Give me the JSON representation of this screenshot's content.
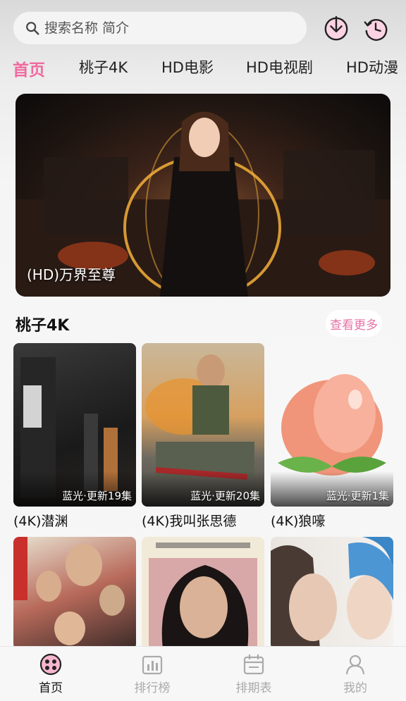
{
  "search": {
    "placeholder": "搜索名称 简介"
  },
  "tabs": [
    {
      "label": "首页"
    },
    {
      "label": "桃子4K"
    },
    {
      "label": "HD电影"
    },
    {
      "label": "HD电视剧"
    },
    {
      "label": "HD动漫"
    }
  ],
  "banner": {
    "title": "(HD)万界至尊"
  },
  "section": {
    "title": "桃子4K",
    "more_label": "查看更多"
  },
  "cards": [
    {
      "title": "(4K)潜渊",
      "tag": "蓝光·更新19集"
    },
    {
      "title": "(4K)我叫张思德",
      "tag": "蓝光·更新20集"
    },
    {
      "title": "(4K)狼嚎",
      "tag": "蓝光·更新1集"
    }
  ],
  "bottom_nav": [
    {
      "label": "首页",
      "icon": "home-icon"
    },
    {
      "label": "排行榜",
      "icon": "ranking-icon"
    },
    {
      "label": "排期表",
      "icon": "schedule-icon"
    },
    {
      "label": "我的",
      "icon": "profile-icon"
    }
  ],
  "colors": {
    "accent": "#f06aa0",
    "nav_inactive": "#aaaaaa"
  }
}
